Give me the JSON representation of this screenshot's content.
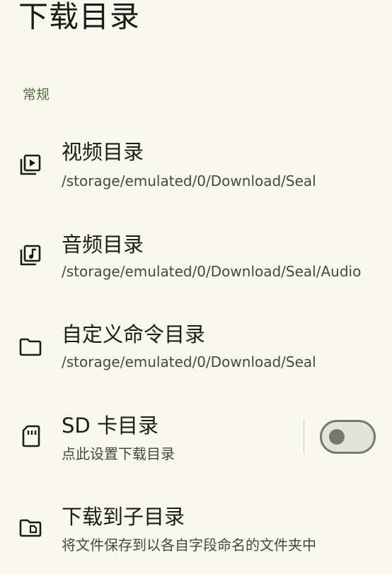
{
  "page": {
    "title": "下载目录"
  },
  "section": {
    "general": "常规"
  },
  "items": [
    {
      "icon": "video-library-icon",
      "title": "视频目录",
      "subtitle": "/storage/emulated/0/Download/Seal"
    },
    {
      "icon": "music-library-icon",
      "title": "音频目录",
      "subtitle": "/storage/emulated/0/Download/Seal/Audio"
    },
    {
      "icon": "folder-icon",
      "title": "自定义命令目录",
      "subtitle": "/storage/emulated/0/Download/Seal"
    },
    {
      "icon": "sd-card-icon",
      "title": "SD 卡目录",
      "subtitle": "点此设置下载目录",
      "toggle": false
    },
    {
      "icon": "subfolder-icon",
      "title": "下载到子目录",
      "subtitle": "将文件保存到以各自字段命名的文件夹中"
    }
  ],
  "colors": {
    "background": "#f8f8ef",
    "section_accent": "#4f6e3a",
    "switch_outline": "#75796c"
  }
}
